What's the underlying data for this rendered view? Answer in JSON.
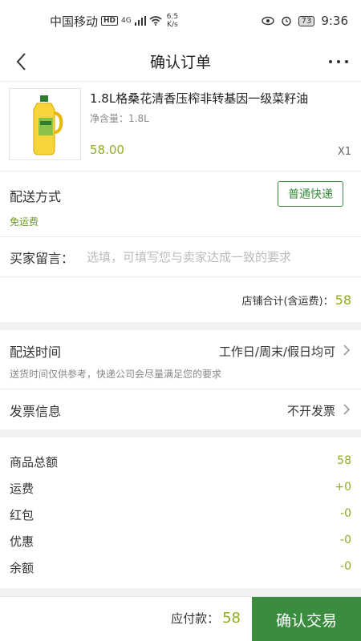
{
  "status_bar": {
    "carrier": "中国移动",
    "hd": "HD",
    "network": "4G",
    "speed_value": "6.5",
    "speed_unit": "K/s",
    "battery": "73",
    "time": "9:36"
  },
  "nav": {
    "title": "确认订单"
  },
  "product": {
    "name": "1.8L格桑花清香压榨非转基因一级菜籽油",
    "spec": "净含量：1.8L",
    "price": "58.00",
    "quantity": "X1"
  },
  "delivery": {
    "label": "配送方式",
    "option": "普通快递",
    "free_shipping": "免运费"
  },
  "message": {
    "label": "买家留言：",
    "placeholder": "选填，可填写您与卖家达成一致的要求"
  },
  "shop_total": {
    "label": "店铺合计(含运费)：",
    "value": "58"
  },
  "delivery_time": {
    "label": "配送时间",
    "value": "工作日/周末/假日均可",
    "note": "送货时间仅供参考，快递公司会尽量满足您的要求"
  },
  "invoice": {
    "label": "发票信息",
    "value": "不开发票"
  },
  "summary": [
    {
      "label": "商品总额",
      "value": "58"
    },
    {
      "label": "运费",
      "value": "+0"
    },
    {
      "label": "红包",
      "value": "-0"
    },
    {
      "label": "优惠",
      "value": "-0"
    },
    {
      "label": "余额",
      "value": "-0"
    }
  ],
  "footer": {
    "due_label": "应付款：",
    "due_amount": "58",
    "confirm_label": "确认交易"
  },
  "colors": {
    "accent_green": "#3a8d3f",
    "price_green": "#8fae1b"
  }
}
